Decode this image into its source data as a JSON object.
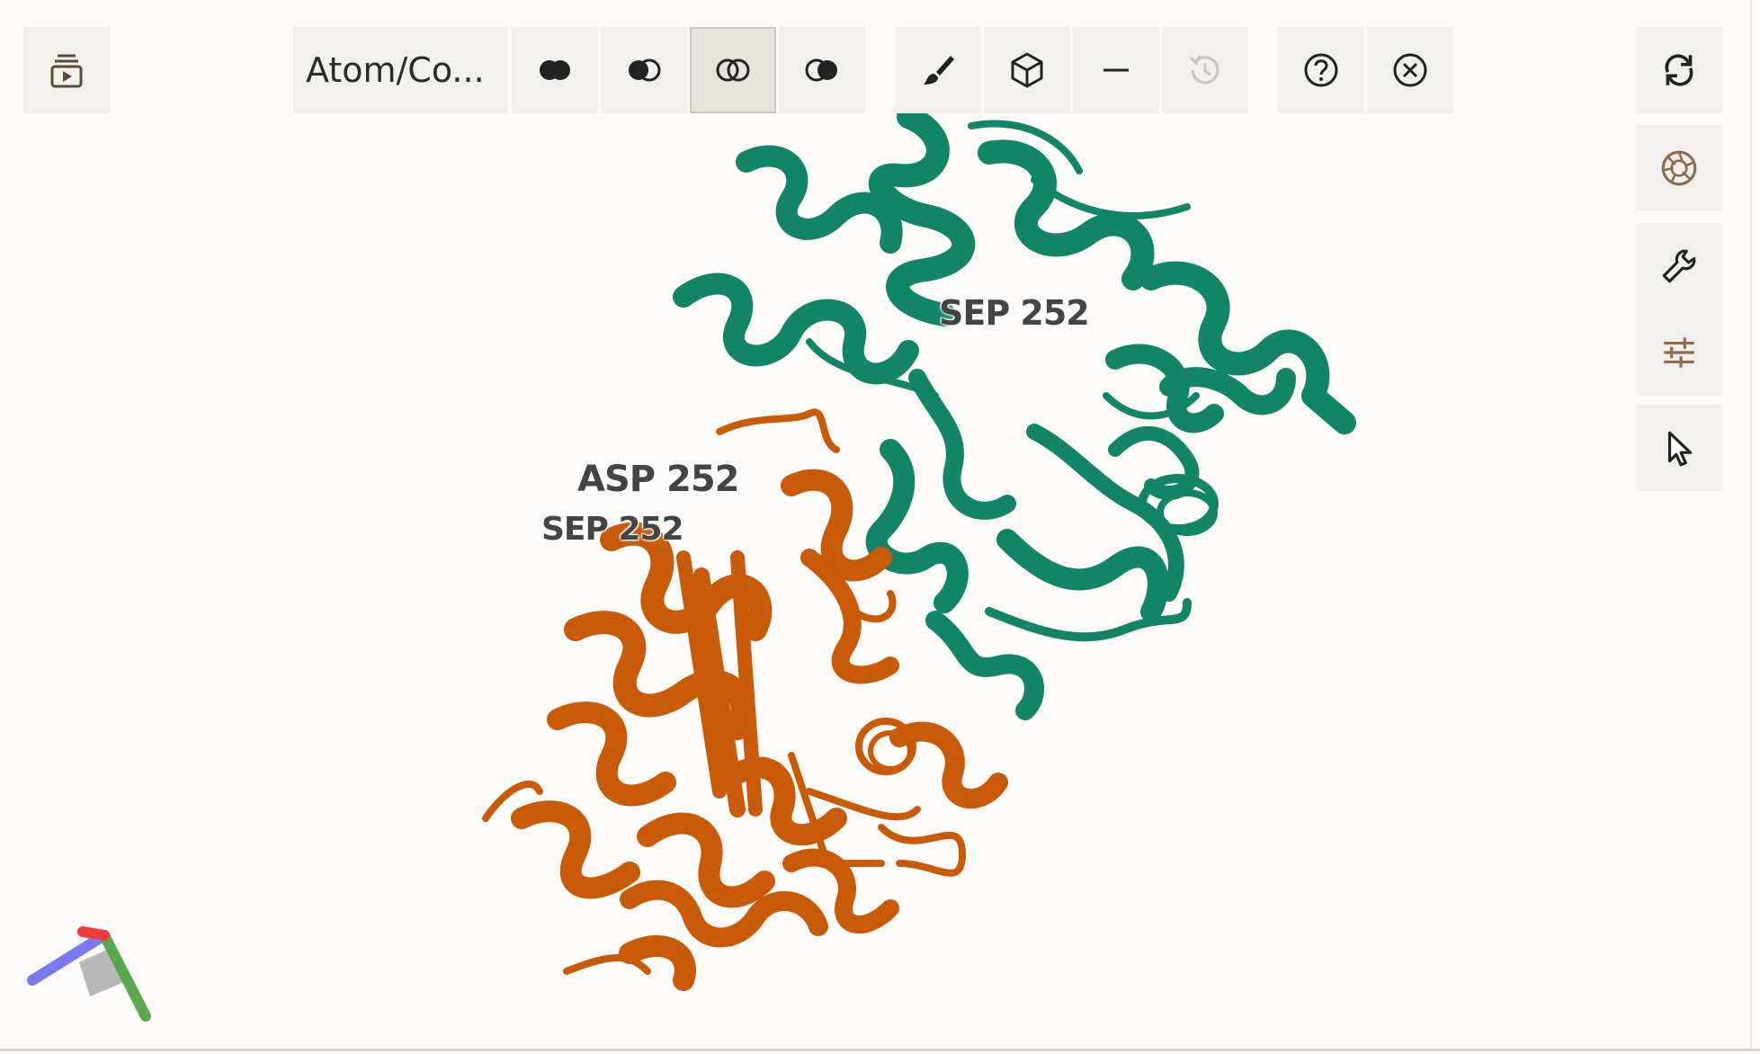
{
  "toolbar": {
    "selection_mode": "Atom/Co...",
    "sequence_icon": "sequence-play-icon",
    "union_icon": "union-icon",
    "subtract_icon": "subtract-icon",
    "intersect_icon": "intersect-icon",
    "set_icon": "set-difference-icon",
    "color_icon": "brush-icon",
    "representation_icon": "cube-icon",
    "clear_icon": "minus-icon",
    "history_icon": "history-icon",
    "help_icon": "help-icon",
    "close_icon": "close-icon"
  },
  "sidebar": {
    "items": [
      "reset-camera-icon",
      "screenshot-icon",
      "wrench-icon",
      "settings-sliders-icon",
      "cursor-icon"
    ]
  },
  "structure_labels": [
    {
      "text": "SEP 252"
    },
    {
      "text": "ASP 252"
    },
    {
      "text": "SEP 252"
    }
  ],
  "colors": {
    "chain_a": "#138567",
    "chain_b": "#c85a08",
    "background": "#fcfbf9",
    "button": "#f2f0ec"
  }
}
